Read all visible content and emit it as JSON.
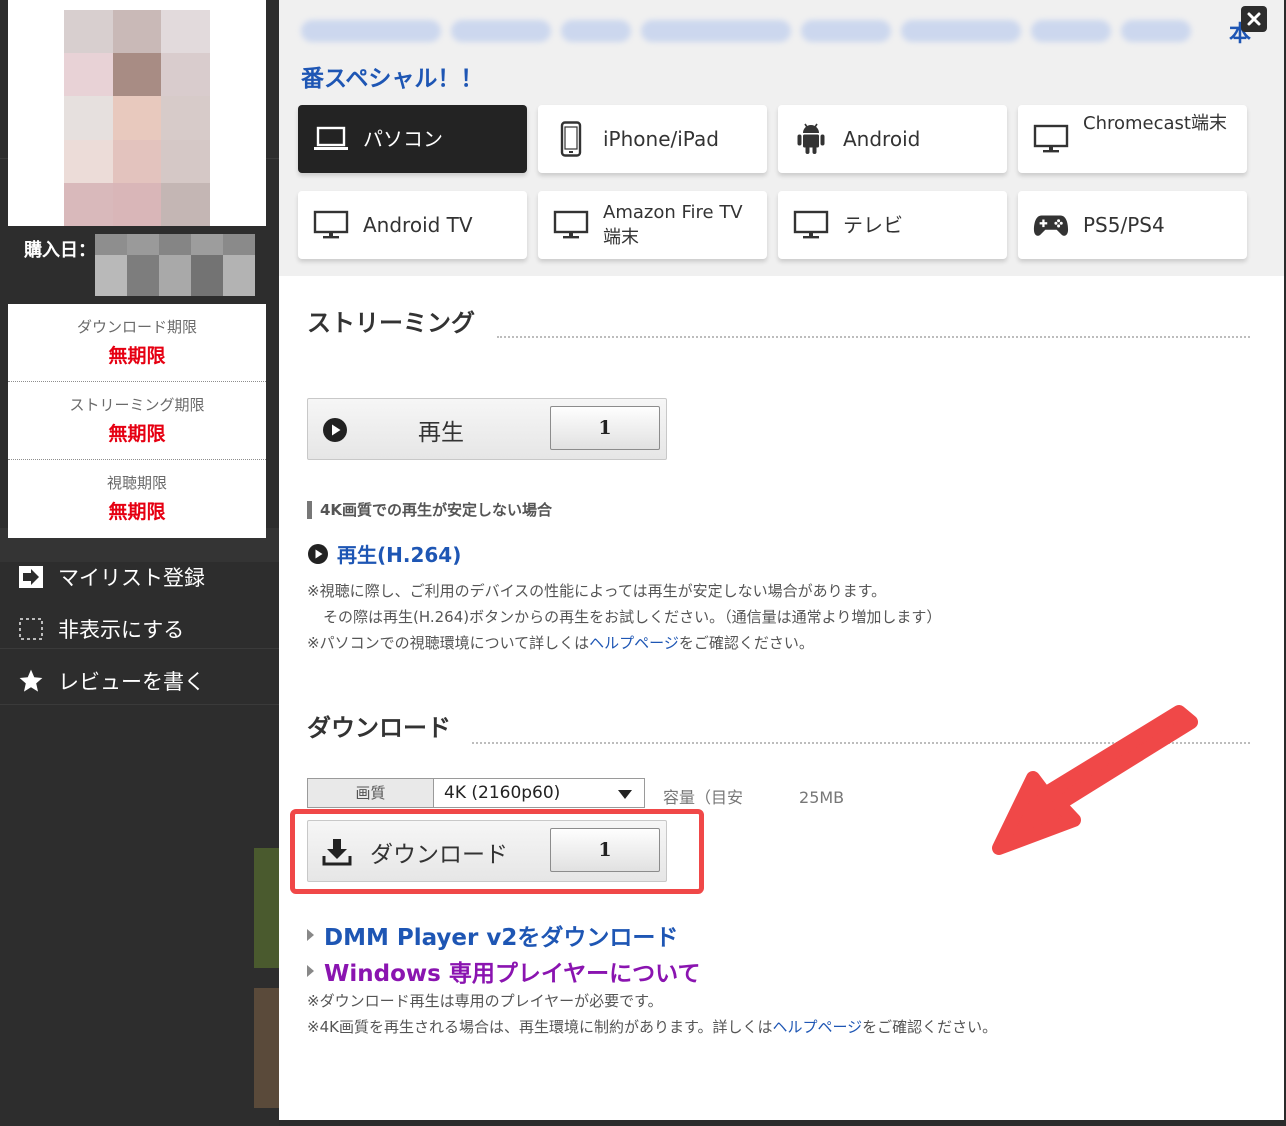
{
  "sidebar": {
    "purchase_date_label": "購入日：",
    "periods": [
      {
        "label": "ダウンロード期限",
        "value": "無期限"
      },
      {
        "label": "ストリーミング期限",
        "value": "無期限"
      },
      {
        "label": "視聴期限",
        "value": "無期限"
      }
    ],
    "actions": [
      {
        "label": "マイリスト登録",
        "icon": "add-to-list-icon"
      },
      {
        "label": "非表示にする",
        "icon": "hide-icon"
      },
      {
        "label": "レビューを書く",
        "icon": "star-icon"
      }
    ]
  },
  "modal": {
    "title_visible_end": "本",
    "title_line2": "番スペシャル！！",
    "devices": [
      {
        "label": "パソコン",
        "icon": "laptop-icon",
        "active": true
      },
      {
        "label": "iPhone/iPad",
        "icon": "phone-icon",
        "active": false
      },
      {
        "label": "Android",
        "icon": "android-icon",
        "active": false
      },
      {
        "label": "Chromecast端末",
        "icon": "monitor-icon",
        "active": false
      },
      {
        "label": "Android TV",
        "icon": "monitor-icon",
        "active": false
      },
      {
        "label": "Amazon Fire TV端末",
        "icon": "monitor-icon",
        "active": false
      },
      {
        "label": "テレビ",
        "icon": "monitor-icon",
        "active": false
      },
      {
        "label": "PS5/PS4",
        "icon": "gamepad-icon",
        "active": false
      }
    ],
    "streaming": {
      "heading": "ストリーミング",
      "play_label": "再生",
      "play_count": "1",
      "note_heading": "4K画質での再生が安定しない場合",
      "h264_label": "再生(H.264)",
      "note1": "※視聴に際し、ご利用のデバイスの性能によっては再生が安定しない場合があります。",
      "note2": "その際は再生(H.264)ボタンからの再生をお試しください。（通信量は通常より増加します）",
      "note3_pre": "※パソコンでの視聴環境について詳しくは",
      "note3_link": "ヘルプページ",
      "note3_post": "をご確認ください。"
    },
    "download": {
      "heading": "ダウンロード",
      "quality_label": "画質",
      "quality_value": "4K (2160p60)",
      "capacity_prefix": "容量（目安",
      "capacity_suffix": "25MB",
      "button_label": "ダウンロード",
      "count": "1",
      "player_link": "DMM Player v2をダウンロード",
      "windows_link": "Windows 専用プレイヤーについて",
      "note1": "※ダウンロード再生は専用のプレイヤーが必要です。",
      "note2_pre": "※4K画質を再生される場合は、再生環境に制約があります。詳しくは",
      "note2_link": "ヘルプページ",
      "note2_post": "をご確認ください。"
    }
  },
  "colors": {
    "link_blue": "#1e56b4",
    "link_purple": "#8a14b0",
    "period_red": "#e60012",
    "highlight_red": "#f04848"
  }
}
